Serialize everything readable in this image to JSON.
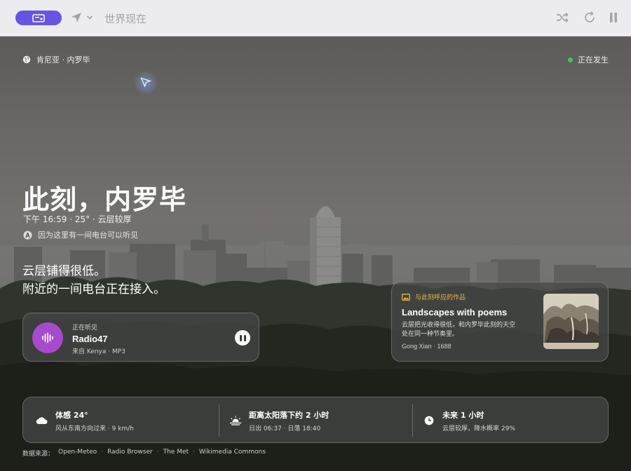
{
  "topbar": {
    "title": "世界现在",
    "icons": [
      "monitor-user-icon",
      "navigation-arrow-icon",
      "chevron-down-icon",
      "shuffle-icon",
      "refresh-icon",
      "pause-icon"
    ]
  },
  "location": {
    "label": "肯尼亚 · 内罗毕",
    "icon": "globe-icon"
  },
  "live": {
    "label": "正在发生",
    "color": "#3fc45a"
  },
  "hero": {
    "headline": "此刻，内罗毕",
    "details": "下午 16:59 · 25° · 云层较厚",
    "reason": "因为这里有一间电台可以听见",
    "story_line1": "云层铺得很低。",
    "story_line2": "附近的一间电台正在接入。"
  },
  "radio": {
    "status": "正在听见",
    "name": "Radio47",
    "origin": "来自 Kenya · MP3",
    "avatar_color": "#a84ad0"
  },
  "artwork": {
    "tag": "与此刻呼应的作品",
    "title": "Landscapes with poems",
    "desc_line1": "云层把光收得很低，和内罗毕此刻的天空",
    "desc_line2": "处在同一种节奏里。",
    "credit": "Gong Xian · 1688",
    "tag_color": "#e8b73a"
  },
  "stats": [
    {
      "icon": "cloud-icon",
      "main": "体感 24°",
      "sub": "风从东南方向过来 · 9 km/h"
    },
    {
      "icon": "sunset-icon",
      "main": "距离太阳落下约 2 小时",
      "sub": "日出 06:37 · 日落 18:40"
    },
    {
      "icon": "clock-icon",
      "main": "未来 1 小时",
      "sub": "云层较厚，降水概率 29%"
    }
  ],
  "sources": {
    "prefix": "数据来源：",
    "items": [
      "Open-Meteo",
      "Radio Browser",
      "The Met",
      "Wikimedia Commons"
    ]
  },
  "colors": {
    "accent": "#6753e6",
    "topbar_bg": "#ececee"
  }
}
